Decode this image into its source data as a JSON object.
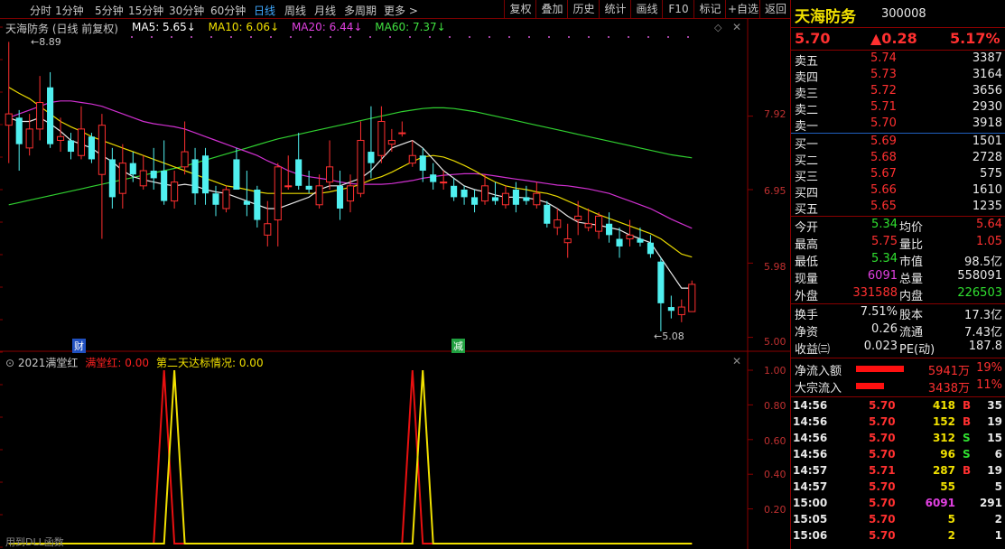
{
  "toolbar": {
    "periods": [
      "分时",
      "1分钟",
      "5分钟",
      "15分钟",
      "30分钟",
      "60分钟",
      "日线",
      "周线",
      "月线",
      "多周期",
      "更多 >"
    ],
    "active_period": "日线",
    "right_buttons": [
      "复权",
      "叠加",
      "历史",
      "统计",
      "画线",
      "F10",
      "标记",
      "+自选",
      "返回"
    ]
  },
  "chart": {
    "title": "天海防务 (日线 前复权)",
    "ma_labels": [
      {
        "text": "MA5: 5.65↓",
        "color": "#ffffff"
      },
      {
        "text": "MA10: 6.06↓",
        "color": "#f0e000"
      },
      {
        "text": "MA20: 6.44↓",
        "color": "#e040e0"
      },
      {
        "text": "MA60: 7.37↓",
        "color": "#40e040"
      }
    ],
    "y_ticks": [
      "7.92",
      "6.95",
      "5.98",
      "5.00"
    ],
    "high_label": "8.89",
    "low_label": "5.08",
    "marker_cai": "财",
    "marker_jian": "减",
    "candles": [
      [
        7.8,
        7.95,
        8.9,
        7.3
      ],
      [
        7.9,
        7.55,
        8.0,
        7.2
      ],
      [
        7.5,
        7.75,
        7.95,
        7.4
      ],
      [
        7.75,
        8.1,
        8.45,
        7.6
      ],
      [
        8.3,
        7.55,
        8.5,
        7.5
      ],
      [
        7.6,
        7.65,
        7.9,
        7.45
      ],
      [
        7.6,
        7.45,
        7.7,
        7.35
      ],
      [
        7.4,
        7.75,
        8.05,
        7.35
      ],
      [
        7.65,
        7.35,
        7.7,
        7.3
      ],
      [
        7.15,
        7.8,
        7.95,
        6.3
      ],
      [
        7.35,
        6.85,
        7.5,
        6.7
      ],
      [
        6.9,
        7.3,
        7.55,
        6.7
      ],
      [
        7.3,
        7.15,
        7.45,
        7.05
      ],
      [
        7.0,
        7.2,
        7.4,
        6.95
      ],
      [
        7.2,
        7.1,
        7.5,
        6.95
      ],
      [
        7.2,
        6.8,
        7.6,
        6.75
      ],
      [
        6.8,
        7.05,
        7.2,
        6.7
      ],
      [
        7.25,
        7.45,
        7.85,
        7.15
      ],
      [
        7.35,
        6.9,
        7.5,
        6.75
      ],
      [
        7.4,
        6.9,
        7.5,
        6.75
      ],
      [
        6.9,
        6.75,
        7.0,
        6.6
      ],
      [
        6.7,
        6.95,
        7.0,
        6.65
      ],
      [
        7.35,
        6.95,
        7.5,
        6.95
      ],
      [
        6.8,
        6.75,
        7.2,
        6.6
      ],
      [
        6.95,
        6.55,
        7.0,
        6.45
      ],
      [
        6.35,
        6.5,
        6.8,
        6.2
      ],
      [
        6.55,
        7.25,
        7.3,
        6.2
      ],
      [
        7.0,
        7.0,
        7.4,
        6.95
      ],
      [
        7.35,
        7.0,
        7.7,
        6.95
      ],
      [
        7.0,
        6.95,
        7.2,
        6.9
      ],
      [
        6.75,
        7.0,
        7.15,
        6.7
      ],
      [
        7.05,
        7.25,
        7.6,
        6.95
      ],
      [
        7.0,
        6.7,
        7.2,
        6.55
      ],
      [
        6.8,
        7.0,
        7.15,
        6.65
      ],
      [
        6.9,
        7.6,
        7.85,
        6.85
      ],
      [
        7.45,
        7.3,
        8.05,
        7.1
      ],
      [
        7.4,
        7.85,
        8.05,
        7.3
      ],
      [
        7.55,
        7.6,
        7.75,
        7.45
      ],
      [
        7.7,
        7.7,
        7.85,
        7.65
      ],
      [
        7.3,
        7.4,
        7.6,
        7.25
      ],
      [
        7.4,
        7.2,
        7.5,
        7.05
      ],
      [
        7.15,
        7.05,
        7.3,
        6.95
      ],
      [
        7.05,
        7.05,
        7.2,
        6.95
      ],
      [
        7.0,
        6.85,
        7.1,
        6.8
      ],
      [
        6.95,
        6.85,
        7.0,
        6.75
      ],
      [
        6.85,
        6.75,
        6.95,
        6.65
      ],
      [
        6.8,
        7.0,
        7.15,
        6.75
      ],
      [
        6.85,
        6.8,
        7.05,
        6.75
      ],
      [
        6.75,
        6.9,
        7.0,
        6.7
      ],
      [
        6.95,
        6.75,
        7.05,
        6.65
      ],
      [
        6.85,
        6.8,
        7.0,
        6.75
      ],
      [
        6.75,
        6.9,
        7.05,
        6.7
      ],
      [
        6.75,
        6.5,
        6.8,
        6.45
      ],
      [
        6.45,
        6.55,
        6.7,
        6.35
      ],
      [
        6.25,
        6.3,
        6.5,
        6.05
      ],
      [
        6.55,
        6.6,
        6.8,
        6.35
      ],
      [
        6.45,
        6.5,
        6.7,
        6.4
      ],
      [
        6.4,
        6.6,
        6.65,
        6.3
      ],
      [
        6.5,
        6.35,
        6.65,
        6.25
      ],
      [
        6.3,
        6.2,
        6.45,
        6.05
      ],
      [
        6.3,
        6.35,
        6.55,
        6.2
      ],
      [
        6.3,
        6.25,
        6.45,
        6.2
      ],
      [
        6.25,
        6.1,
        6.35,
        6.05
      ],
      [
        6.0,
        5.45,
        6.05,
        5.08
      ],
      [
        5.4,
        5.35,
        5.55,
        5.25
      ],
      [
        5.3,
        5.4,
        5.5,
        5.2
      ],
      [
        5.34,
        5.7,
        5.75,
        5.34
      ]
    ],
    "ma5": [
      7.9,
      7.85,
      7.85,
      7.9,
      7.82,
      7.72,
      7.6,
      7.55,
      7.5,
      7.4,
      7.32,
      7.2,
      7.12,
      7.08,
      7.05,
      7.02,
      7.0,
      7.02,
      7.0,
      6.95,
      6.92,
      6.9,
      6.85,
      6.8,
      6.75,
      6.7,
      6.7,
      6.75,
      6.8,
      6.85,
      6.95,
      7.0,
      7.0,
      7.05,
      7.1,
      7.2,
      7.35,
      7.5,
      7.55,
      7.6,
      7.5,
      7.35,
      7.2,
      7.1,
      7.0,
      6.95,
      6.92,
      6.88,
      6.85,
      6.85,
      6.84,
      6.82,
      6.78,
      6.7,
      6.6,
      6.52,
      6.5,
      6.48,
      6.45,
      6.42,
      6.35,
      6.3,
      6.25,
      6.05,
      5.85,
      5.65,
      5.65
    ],
    "ma10": [
      8.3,
      8.22,
      8.15,
      8.05,
      7.95,
      7.85,
      7.78,
      7.72,
      7.65,
      7.6,
      7.55,
      7.5,
      7.45,
      7.4,
      7.35,
      7.3,
      7.25,
      7.2,
      7.15,
      7.1,
      7.05,
      7.0,
      6.98,
      6.95,
      6.92,
      6.9,
      6.9,
      6.9,
      6.9,
      6.9,
      6.9,
      6.92,
      6.95,
      6.98,
      7.02,
      7.08,
      7.12,
      7.18,
      7.25,
      7.32,
      7.38,
      7.4,
      7.38,
      7.33,
      7.27,
      7.2,
      7.12,
      7.05,
      7.0,
      6.97,
      6.95,
      6.92,
      6.9,
      6.86,
      6.8,
      6.74,
      6.68,
      6.62,
      6.57,
      6.52,
      6.47,
      6.42,
      6.37,
      6.3,
      6.2,
      6.1,
      6.06
    ],
    "ma20": [
      7.9,
      7.95,
      8.0,
      8.05,
      8.1,
      8.12,
      8.12,
      8.1,
      8.08,
      8.05,
      8.0,
      7.95,
      7.9,
      7.85,
      7.82,
      7.8,
      7.78,
      7.75,
      7.7,
      7.65,
      7.6,
      7.55,
      7.5,
      7.45,
      7.4,
      7.33,
      7.27,
      7.2,
      7.15,
      7.12,
      7.1,
      7.08,
      7.05,
      7.03,
      7.02,
      7.02,
      7.02,
      7.03,
      7.05,
      7.07,
      7.1,
      7.12,
      7.14,
      7.15,
      7.16,
      7.16,
      7.15,
      7.13,
      7.11,
      7.09,
      7.07,
      7.05,
      7.03,
      7.01,
      7.0,
      6.98,
      6.96,
      6.93,
      6.9,
      6.85,
      6.8,
      6.75,
      6.7,
      6.63,
      6.56,
      6.5,
      6.44
    ],
    "ma60": [
      6.75,
      6.78,
      6.81,
      6.84,
      6.87,
      6.9,
      6.93,
      6.96,
      6.99,
      7.02,
      7.05,
      7.08,
      7.11,
      7.14,
      7.17,
      7.2,
      7.23,
      7.26,
      7.3,
      7.34,
      7.38,
      7.42,
      7.46,
      7.5,
      7.54,
      7.58,
      7.62,
      7.65,
      7.68,
      7.71,
      7.74,
      7.77,
      7.8,
      7.83,
      7.86,
      7.89,
      7.92,
      7.95,
      7.98,
      8.0,
      8.02,
      8.03,
      8.03,
      8.02,
      8.0,
      7.98,
      7.95,
      7.92,
      7.89,
      7.86,
      7.83,
      7.8,
      7.77,
      7.74,
      7.71,
      7.68,
      7.65,
      7.62,
      7.59,
      7.56,
      7.53,
      7.5,
      7.47,
      7.44,
      7.41,
      7.39,
      7.37
    ]
  },
  "indicator": {
    "name": "2021满堂红",
    "label1": "满堂红: 0.00",
    "label1_color": "#ff2020",
    "label2": "第二天达标情况: 0.00",
    "label2_color": "#f0e000",
    "y_ticks": [
      "1.00",
      "0.80",
      "0.60",
      "0.40",
      "0.20"
    ],
    "footer": "用到DLL函数",
    "red_peaks": [
      15,
      39
    ],
    "yellow_peaks": [
      16,
      40
    ]
  },
  "quote": {
    "name": "天海防务",
    "code": "300008",
    "price": "5.70",
    "change": "▲0.28",
    "change_pct": "5.17%",
    "asks": [
      {
        "label": "卖五",
        "price": "5.74",
        "vol": "3387"
      },
      {
        "label": "卖四",
        "price": "5.73",
        "vol": "3164"
      },
      {
        "label": "卖三",
        "price": "5.72",
        "vol": "3656"
      },
      {
        "label": "卖二",
        "price": "5.71",
        "vol": "2930"
      },
      {
        "label": "卖一",
        "price": "5.70",
        "vol": "3918"
      }
    ],
    "bids": [
      {
        "label": "买一",
        "price": "5.69",
        "vol": "1501"
      },
      {
        "label": "买二",
        "price": "5.68",
        "vol": "2728"
      },
      {
        "label": "买三",
        "price": "5.67",
        "vol": "575"
      },
      {
        "label": "买四",
        "price": "5.66",
        "vol": "1610"
      },
      {
        "label": "买五",
        "price": "5.65",
        "vol": "1235"
      }
    ],
    "stats1": [
      {
        "l1": "今开",
        "v1": "5.34",
        "c1": "green",
        "l2": "均价",
        "v2": "5.64",
        "c2": "red"
      },
      {
        "l1": "最高",
        "v1": "5.75",
        "c1": "red",
        "l2": "量比",
        "v2": "1.05",
        "c2": "red"
      },
      {
        "l1": "最低",
        "v1": "5.34",
        "c1": "green",
        "l2": "市值",
        "v2": "98.5亿",
        "c2": "white"
      },
      {
        "l1": "现量",
        "v1": "6091",
        "c1": "purple",
        "l2": "总量",
        "v2": "558091",
        "c2": "white"
      },
      {
        "l1": "外盘",
        "v1": "331588",
        "c1": "red",
        "l2": "内盘",
        "v2": "226503",
        "c2": "green"
      }
    ],
    "stats2": [
      {
        "l1": "换手",
        "v1": "7.51%",
        "l2": "股本",
        "v2": "17.3亿"
      },
      {
        "l1": "净资",
        "v1": "0.26",
        "l2": "流通",
        "v2": "7.43亿"
      },
      {
        "l1": "收益㈢",
        "v1": "0.023",
        "l2": "PE(动)",
        "v2": "187.8"
      }
    ],
    "flows": [
      {
        "label": "净流入额",
        "value": "5941万",
        "pct": "19%",
        "fill": 0.19
      },
      {
        "label": "大宗流入",
        "value": "3438万",
        "pct": "11%",
        "fill": 0.11
      }
    ],
    "trades": [
      {
        "time": "14:56",
        "price": "5.70",
        "vol": "418",
        "side": "B",
        "n": "35"
      },
      {
        "time": "14:56",
        "price": "5.70",
        "vol": "152",
        "side": "B",
        "n": "19"
      },
      {
        "time": "14:56",
        "price": "5.70",
        "vol": "312",
        "side": "S",
        "n": "15"
      },
      {
        "time": "14:56",
        "price": "5.70",
        "vol": "96",
        "side": "S",
        "n": "6"
      },
      {
        "time": "14:57",
        "price": "5.71",
        "vol": "287",
        "side": "B",
        "n": "19"
      },
      {
        "time": "14:57",
        "price": "5.70",
        "vol": "55",
        "side": "",
        "n": "5"
      },
      {
        "time": "15:00",
        "price": "5.70",
        "vol": "6091",
        "side": "",
        "n": "291"
      },
      {
        "time": "15:05",
        "price": "5.70",
        "vol": "5",
        "side": "",
        "n": "2"
      },
      {
        "time": "15:06",
        "price": "5.70",
        "vol": "2",
        "side": "",
        "n": "1"
      }
    ]
  }
}
